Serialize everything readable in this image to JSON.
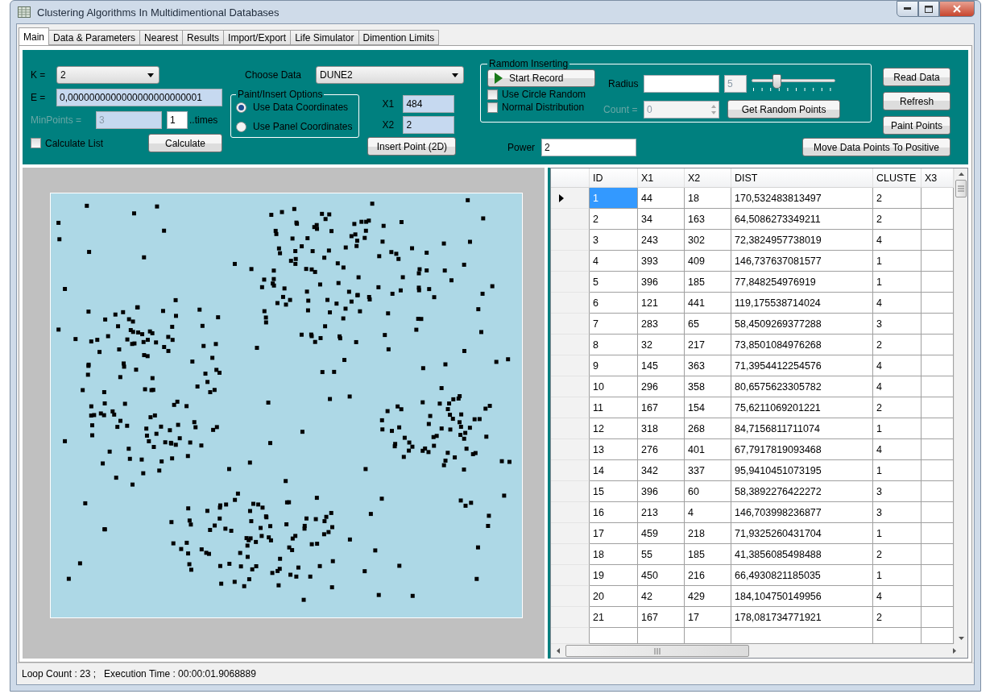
{
  "window": {
    "title": "Clustering Algorithms In Multidimentional Databases"
  },
  "tabs": [
    {
      "label": "Main",
      "selected": true
    },
    {
      "label": "Data & Parameters",
      "selected": false
    },
    {
      "label": "Nearest",
      "selected": false
    },
    {
      "label": "Results",
      "selected": false
    },
    {
      "label": "Import/Export",
      "selected": false
    },
    {
      "label": "Life Simulator",
      "selected": false
    },
    {
      "label": "Dimention Limits",
      "selected": false
    }
  ],
  "parameters": {
    "k_label": "K =",
    "k_value": "2",
    "e_label": "E =",
    "e_value": "0,0000000000000000000000001",
    "minpoints_label": "MinPoints =",
    "minpoints_value": "3",
    "minpoints_disabled": true,
    "times_value": "1",
    "times_label": "..times",
    "calculate_list": {
      "label": "Calculate List",
      "checked": false
    },
    "calculate_button": "Calculate"
  },
  "data_choice": {
    "label": "Choose Data",
    "value": "DUNE2"
  },
  "paint_insert_options": {
    "title": "Paint/Insert Options",
    "options": [
      {
        "label": "Use Data Coordinates",
        "selected": true
      },
      {
        "label": "Use Panel Coordinates",
        "selected": false
      }
    ]
  },
  "insert_point": {
    "x1_label": "X1",
    "x1_value": "484",
    "x2_label": "X2",
    "x2_value": "2",
    "button": "Insert Point (2D)"
  },
  "random_inserting": {
    "title": "Ramdom Inserting",
    "record_button": "Start Record",
    "use_circle_random": {
      "label": "Use Circle Random",
      "checked": false
    },
    "normal_distribution": {
      "label": "Normal Distribution",
      "checked": false
    },
    "radius_label": "Radius",
    "radius_value_box": "5",
    "slider": {
      "level": 0.3
    },
    "count_label": "Count =",
    "count_value": "0",
    "get_button": "Get Random Points"
  },
  "power": {
    "label": "Power",
    "value": "2"
  },
  "side_buttons": [
    "Read Data",
    "Refresh",
    "Paint Points"
  ],
  "move_button": "Move Data Points To Positive",
  "table": {
    "columns": [
      "ID",
      "X1",
      "X2",
      "DIST",
      "CLUSTE",
      "X3"
    ],
    "rows": [
      {
        "selected": true,
        "cells": [
          "1",
          "44",
          "18",
          "170,532483813497",
          "2"
        ]
      },
      {
        "selected": false,
        "cells": [
          "2",
          "34",
          "163",
          "64,5086273349211",
          "2"
        ]
      },
      {
        "selected": false,
        "cells": [
          "3",
          "243",
          "302",
          "72,3824957738019",
          "4"
        ]
      },
      {
        "selected": false,
        "cells": [
          "4",
          "393",
          "409",
          "146,737637081577",
          "1"
        ]
      },
      {
        "selected": false,
        "cells": [
          "5",
          "396",
          "185",
          "77,848254976919",
          "1"
        ]
      },
      {
        "selected": false,
        "cells": [
          "6",
          "121",
          "441",
          "119,175538714024",
          "4"
        ]
      },
      {
        "selected": false,
        "cells": [
          "7",
          "283",
          "65",
          "58,4509269377288",
          "3"
        ]
      },
      {
        "selected": false,
        "cells": [
          "8",
          "32",
          "217",
          "73,8501084976268",
          "2"
        ]
      },
      {
        "selected": false,
        "cells": [
          "9",
          "145",
          "363",
          "71,3954412254576",
          "4"
        ]
      },
      {
        "selected": false,
        "cells": [
          "10",
          "296",
          "358",
          "80,6575623305782",
          "4"
        ]
      },
      {
        "selected": false,
        "cells": [
          "11",
          "167",
          "154",
          "75,6211069201221",
          "2"
        ]
      },
      {
        "selected": false,
        "cells": [
          "12",
          "318",
          "268",
          "84,7156811711074",
          "1"
        ]
      },
      {
        "selected": false,
        "cells": [
          "13",
          "276",
          "401",
          "67,7917819093468",
          "4"
        ]
      },
      {
        "selected": false,
        "cells": [
          "14",
          "342",
          "337",
          "95,9410451073195",
          "1"
        ]
      },
      {
        "selected": false,
        "cells": [
          "15",
          "396",
          "60",
          "58,3892276422272",
          "3"
        ]
      },
      {
        "selected": false,
        "cells": [
          "16",
          "213",
          "4",
          "146,703998236877",
          "3"
        ]
      },
      {
        "selected": false,
        "cells": [
          "17",
          "459",
          "218",
          "71,9325260431704",
          "1"
        ]
      },
      {
        "selected": false,
        "cells": [
          "18",
          "55",
          "185",
          "41,3856085498488",
          "2"
        ]
      },
      {
        "selected": false,
        "cells": [
          "19",
          "450",
          "216",
          "66,4930821185035",
          "1"
        ]
      },
      {
        "selected": false,
        "cells": [
          "20",
          "42",
          "429",
          "184,104750149956",
          "4"
        ]
      },
      {
        "selected": false,
        "cells": [
          "21",
          "167",
          "17",
          "178,081734771921",
          "2"
        ]
      }
    ]
  },
  "status_bar": {
    "loop_count": "Loop Count :  23 ;",
    "execution_time": "Execution Time :   00:00:01.9068889"
  }
}
